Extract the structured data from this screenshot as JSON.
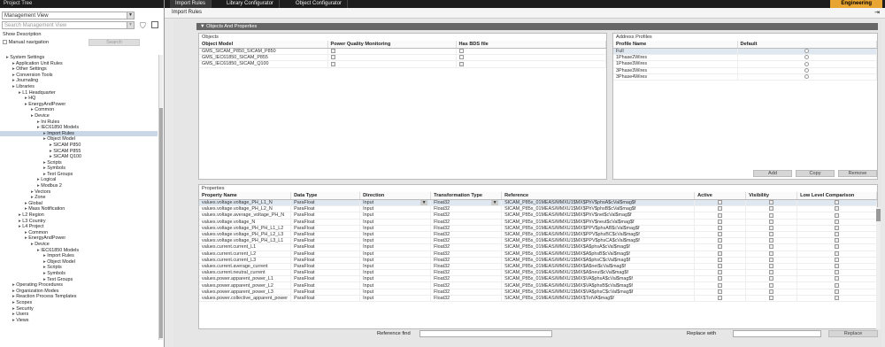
{
  "left": {
    "header": "Project Tree",
    "view_select": "Management View",
    "search_placeholder": "Search Management View",
    "show_description": "Show Description",
    "manual_navigation": "Manual navigation",
    "search_button": "Search",
    "tree": [
      {
        "label": "System Settings",
        "indent": 1
      },
      {
        "label": "Application Unit Rules",
        "indent": 2
      },
      {
        "label": "Other Settings",
        "indent": 2
      },
      {
        "label": "Conversion Tools",
        "indent": 2
      },
      {
        "label": "Journaling",
        "indent": 2
      },
      {
        "label": "Libraries",
        "indent": 2
      },
      {
        "label": "L1 Headquarter",
        "indent": 3
      },
      {
        "label": "HQ",
        "indent": 4
      },
      {
        "label": "EnergyAndPower",
        "indent": 4
      },
      {
        "label": "Common",
        "indent": 5
      },
      {
        "label": "Device",
        "indent": 5
      },
      {
        "label": "Ini Rules",
        "indent": 6
      },
      {
        "label": "IEC61850 Models",
        "indent": 6
      },
      {
        "label": "Import Rules",
        "indent": 7,
        "selected": true
      },
      {
        "label": "Object Model",
        "indent": 7
      },
      {
        "label": "SICAM P850",
        "indent": 8
      },
      {
        "label": "SICAM P855",
        "indent": 8
      },
      {
        "label": "SICAM Q100",
        "indent": 8
      },
      {
        "label": "Scripts",
        "indent": 7
      },
      {
        "label": "Symbols",
        "indent": 7
      },
      {
        "label": "Text Groups",
        "indent": 7
      },
      {
        "label": "Logical",
        "indent": 6
      },
      {
        "label": "Modbus 2",
        "indent": 6
      },
      {
        "label": "Vectors",
        "indent": 5
      },
      {
        "label": "Zone",
        "indent": 5
      },
      {
        "label": "Global",
        "indent": 4
      },
      {
        "label": "Mass Notification",
        "indent": 4
      },
      {
        "label": "L2 Region",
        "indent": 3
      },
      {
        "label": "L3 Country",
        "indent": 3
      },
      {
        "label": "L4 Project",
        "indent": 3
      },
      {
        "label": "Common",
        "indent": 4
      },
      {
        "label": "EnergyAndPower",
        "indent": 4
      },
      {
        "label": "Device",
        "indent": 5
      },
      {
        "label": "IEC61850 Models",
        "indent": 6
      },
      {
        "label": "Import Rules",
        "indent": 7
      },
      {
        "label": "Object Model",
        "indent": 7
      },
      {
        "label": "Scripts",
        "indent": 7
      },
      {
        "label": "Symbols",
        "indent": 7
      },
      {
        "label": "Text Groups",
        "indent": 7
      },
      {
        "label": "Operating Procedures",
        "indent": 2
      },
      {
        "label": "Organization Modes",
        "indent": 2
      },
      {
        "label": "Reaction Process Templates",
        "indent": 2
      },
      {
        "label": "Scopes",
        "indent": 2
      },
      {
        "label": "Security",
        "indent": 2
      },
      {
        "label": "Users",
        "indent": 2
      },
      {
        "label": "Views",
        "indent": 2
      }
    ]
  },
  "tabs": [
    "Import Rules",
    "Library Configurator",
    "Object Configurator"
  ],
  "mode": "Engineering",
  "subheader": "Import Rules",
  "section_title": "Objects And Properties",
  "objects": {
    "label": "Objects",
    "columns": [
      "Object Model",
      "Power Quality Monitoring",
      "Has BDS file"
    ],
    "rows": [
      {
        "name": "GMS_SICAM_P850_SICAM_P850"
      },
      {
        "name": "GMS_IEC61850_SICAM_P855"
      },
      {
        "name": "GMS_IEC61850_SICAM_Q100"
      }
    ]
  },
  "address_profiles": {
    "label": "Address Profiles",
    "columns": [
      "Profile Name",
      "Default"
    ],
    "rows": [
      "Full",
      "1Phase2Wires",
      "1Phase3Wires",
      "3Phase3Wires",
      "3Phase4Wires"
    ],
    "buttons": [
      "Add",
      "Copy",
      "Remove"
    ]
  },
  "properties": {
    "label": "Properties",
    "columns": [
      "Property Name",
      "Data Type",
      "Direction",
      "Transformation Type",
      "Reference",
      "Active",
      "Visibility",
      "Low Level Comparison"
    ],
    "rows": [
      {
        "name": "values.voltage.voltage_PH_L1_N",
        "type": "ParaFloat",
        "dir": "Input",
        "trans": "Float32",
        "ref": "SICAM_P85x_01MEAS/MMXU1$MX$PhV$phsA$cVal$mag$f"
      },
      {
        "name": "values.voltage.voltage_PH_L2_N",
        "type": "ParaFloat",
        "dir": "Input",
        "trans": "Float32",
        "ref": "SICAM_P85x_01MEAS/MMXU1$MX$PhV$phsB$cVal$mag$f"
      },
      {
        "name": "values.voltage.average_voltage_PH_N",
        "type": "ParaFloat",
        "dir": "Input",
        "trans": "Float32",
        "ref": "SICAM_P85x_01MEAS/MMXU1$MX$PhV$net$cVal$mag$f"
      },
      {
        "name": "values.voltage.voltage_N",
        "type": "ParaFloat",
        "dir": "Input",
        "trans": "Float32",
        "ref": "SICAM_P85x_01MEAS/MMXU1$MX$PhV$neut$cVal$mag$f"
      },
      {
        "name": "values.voltage.voltage_PH_PH_L1_L2",
        "type": "ParaFloat",
        "dir": "Input",
        "trans": "Float32",
        "ref": "SICAM_P85x_01MEAS/MMXU1$MX$PPV$phsAB$cVal$mag$f"
      },
      {
        "name": "values.voltage.voltage_PH_PH_L2_L3",
        "type": "ParaFloat",
        "dir": "Input",
        "trans": "Float32",
        "ref": "SICAM_P85x_01MEAS/MMXU1$MX$PPV$phsBC$cVal$mag$f"
      },
      {
        "name": "values.voltage.voltage_PH_PH_L3_L1",
        "type": "ParaFloat",
        "dir": "Input",
        "trans": "Float32",
        "ref": "SICAM_P85x_01MEAS/MMXU1$MX$PPV$phsCA$cVal$mag$f"
      },
      {
        "name": "values.current.current_L1",
        "type": "ParaFloat",
        "dir": "Input",
        "trans": "Float32",
        "ref": "SICAM_P85x_01MEAS/MMXU1$MX$A$phsA$cVal$mag$f"
      },
      {
        "name": "values.current.current_L2",
        "type": "ParaFloat",
        "dir": "Input",
        "trans": "Float32",
        "ref": "SICAM_P85x_01MEAS/MMXU1$MX$A$phsB$cVal$mag$f"
      },
      {
        "name": "values.current.current_L3",
        "type": "ParaFloat",
        "dir": "Input",
        "trans": "Float32",
        "ref": "SICAM_P85x_01MEAS/MMXU1$MX$A$phsC$cVal$mag$f"
      },
      {
        "name": "values.current.average_current",
        "type": "ParaFloat",
        "dir": "Input",
        "trans": "Float32",
        "ref": "SICAM_P85x_01MEAS/MMXU1$MX$A$net$cVal$mag$f"
      },
      {
        "name": "values.current.neutral_current",
        "type": "ParaFloat",
        "dir": "Input",
        "trans": "Float32",
        "ref": "SICAM_P85x_01MEAS/MMXU1$MX$A$neut$cVal$mag$f"
      },
      {
        "name": "values.power.apparent_power_L1",
        "type": "ParaFloat",
        "dir": "Input",
        "trans": "Float32",
        "ref": "SICAM_P85x_01MEAS/MMXU1$MX$VA$phsA$cVal$mag$f"
      },
      {
        "name": "values.power.apparent_power_L2",
        "type": "ParaFloat",
        "dir": "Input",
        "trans": "Float32",
        "ref": "SICAM_P85x_01MEAS/MMXU1$MX$VA$phsB$cVal$mag$f"
      },
      {
        "name": "values.power.apparent_power_L3",
        "type": "ParaFloat",
        "dir": "Input",
        "trans": "Float32",
        "ref": "SICAM_P85x_01MEAS/MMXU1$MX$VA$phsC$cVal$mag$f"
      },
      {
        "name": "values.power.collective_apparent_power",
        "type": "ParaFloat",
        "dir": "Input",
        "trans": "Float32",
        "ref": "SICAM_P85x_01MEAS/MMXU1$MX$TotVA$mag$f"
      }
    ]
  },
  "footer": {
    "reference_find": "Reference find",
    "replace_with": "Replace with",
    "replace_button": "Replace"
  }
}
